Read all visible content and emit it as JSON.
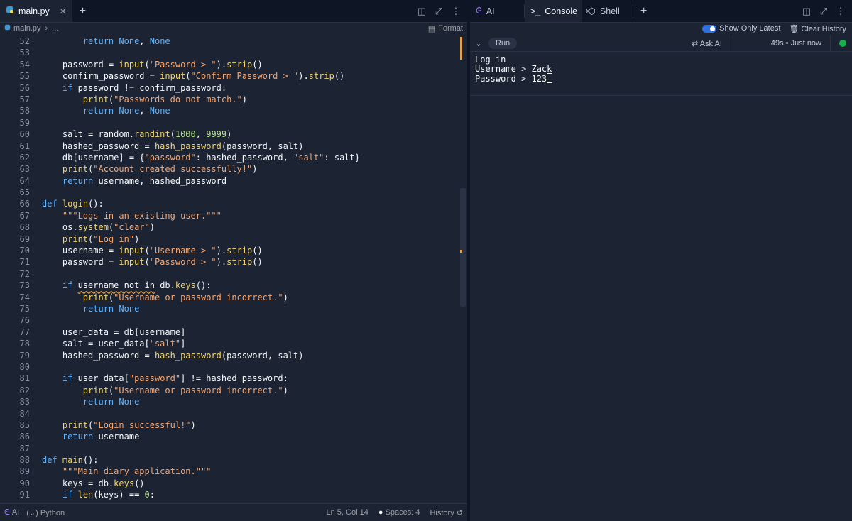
{
  "editor": {
    "tab_label": "main.py",
    "breadcrumb_file": "main.py",
    "breadcrumb_more": "...",
    "format_label": "Format",
    "lines": [
      {
        "n": "52",
        "code": [
          [
            "        ",
            "p"
          ],
          [
            "return",
            "kw"
          ],
          [
            " ",
            "p"
          ],
          [
            "None",
            "const"
          ],
          [
            ", ",
            "p"
          ],
          [
            "None",
            "const"
          ]
        ]
      },
      {
        "n": "53",
        "code": []
      },
      {
        "n": "54",
        "code": [
          [
            "    password = ",
            "p"
          ],
          [
            "input",
            "fn"
          ],
          [
            "(",
            "p"
          ],
          [
            "\"Password > \"",
            "str"
          ],
          [
            ").",
            "p"
          ],
          [
            "strip",
            "fn"
          ],
          [
            "()",
            "p"
          ]
        ]
      },
      {
        "n": "55",
        "code": [
          [
            "    confirm_password = ",
            "p"
          ],
          [
            "input",
            "fn"
          ],
          [
            "(",
            "p"
          ],
          [
            "\"Confirm Password > \"",
            "str"
          ],
          [
            ").",
            "p"
          ],
          [
            "strip",
            "fn"
          ],
          [
            "()",
            "p"
          ]
        ]
      },
      {
        "n": "56",
        "code": [
          [
            "    ",
            "p"
          ],
          [
            "if",
            "kw"
          ],
          [
            " password != confirm_password:",
            "p"
          ]
        ]
      },
      {
        "n": "57",
        "code": [
          [
            "        ",
            "p"
          ],
          [
            "print",
            "fn"
          ],
          [
            "(",
            "p"
          ],
          [
            "\"Passwords do not match.\"",
            "str"
          ],
          [
            ")",
            "p"
          ]
        ]
      },
      {
        "n": "58",
        "code": [
          [
            "        ",
            "p"
          ],
          [
            "return",
            "kw"
          ],
          [
            " ",
            "p"
          ],
          [
            "None",
            "const"
          ],
          [
            ", ",
            "p"
          ],
          [
            "None",
            "const"
          ]
        ]
      },
      {
        "n": "59",
        "code": []
      },
      {
        "n": "60",
        "code": [
          [
            "    salt = random.",
            "p"
          ],
          [
            "randint",
            "fn"
          ],
          [
            "(",
            "p"
          ],
          [
            "1000",
            "num"
          ],
          [
            ", ",
            "p"
          ],
          [
            "9999",
            "num"
          ],
          [
            ")",
            "p"
          ]
        ]
      },
      {
        "n": "61",
        "code": [
          [
            "    hashed_password = ",
            "p"
          ],
          [
            "hash_password",
            "fn"
          ],
          [
            "(password, salt)",
            "p"
          ]
        ]
      },
      {
        "n": "62",
        "code": [
          [
            "    db[username] = {",
            "p"
          ],
          [
            "\"password\"",
            "str"
          ],
          [
            ": hashed_password, ",
            "p"
          ],
          [
            "\"salt\"",
            "str"
          ],
          [
            ": salt}",
            "p"
          ]
        ]
      },
      {
        "n": "63",
        "code": [
          [
            "    ",
            "p"
          ],
          [
            "print",
            "fn"
          ],
          [
            "(",
            "p"
          ],
          [
            "\"Account created successfully!\"",
            "str"
          ],
          [
            ")",
            "p"
          ]
        ]
      },
      {
        "n": "64",
        "code": [
          [
            "    ",
            "p"
          ],
          [
            "return",
            "kw"
          ],
          [
            " username, hashed_password",
            "p"
          ]
        ]
      },
      {
        "n": "65",
        "code": []
      },
      {
        "n": "66",
        "code": [
          [
            "def",
            "kw"
          ],
          [
            " ",
            "p"
          ],
          [
            "login",
            "fn"
          ],
          [
            "():",
            "p"
          ]
        ]
      },
      {
        "n": "67",
        "code": [
          [
            "    ",
            "p"
          ],
          [
            "\"\"\"Logs in an existing user.\"\"\"",
            "doc"
          ]
        ]
      },
      {
        "n": "68",
        "code": [
          [
            "    os.",
            "p"
          ],
          [
            "system",
            "fn"
          ],
          [
            "(",
            "p"
          ],
          [
            "\"clear\"",
            "str"
          ],
          [
            ")",
            "p"
          ]
        ]
      },
      {
        "n": "69",
        "code": [
          [
            "    ",
            "p"
          ],
          [
            "print",
            "fn"
          ],
          [
            "(",
            "p"
          ],
          [
            "\"Log in\"",
            "str"
          ],
          [
            ")",
            "p"
          ]
        ]
      },
      {
        "n": "70",
        "code": [
          [
            "    username = ",
            "p"
          ],
          [
            "input",
            "fn"
          ],
          [
            "(",
            "p"
          ],
          [
            "\"Username > \"",
            "str"
          ],
          [
            ").",
            "p"
          ],
          [
            "strip",
            "fn"
          ],
          [
            "()",
            "p"
          ]
        ]
      },
      {
        "n": "71",
        "code": [
          [
            "    password = ",
            "p"
          ],
          [
            "input",
            "fn"
          ],
          [
            "(",
            "p"
          ],
          [
            "\"Password > \"",
            "str"
          ],
          [
            ").",
            "p"
          ],
          [
            "strip",
            "fn"
          ],
          [
            "()",
            "p"
          ]
        ]
      },
      {
        "n": "72",
        "code": []
      },
      {
        "n": "73",
        "code": [
          [
            "    ",
            "p"
          ],
          [
            "if",
            "kw"
          ],
          [
            " ",
            "p"
          ],
          [
            "username not in",
            "sq"
          ],
          [
            " db.",
            "p"
          ],
          [
            "keys",
            "fn"
          ],
          [
            "():",
            "p"
          ]
        ]
      },
      {
        "n": "74",
        "code": [
          [
            "        ",
            "p"
          ],
          [
            "print",
            "fn"
          ],
          [
            "(",
            "p"
          ],
          [
            "\"Username or password incorrect.\"",
            "str"
          ],
          [
            ")",
            "p"
          ]
        ]
      },
      {
        "n": "75",
        "code": [
          [
            "        ",
            "p"
          ],
          [
            "return",
            "kw"
          ],
          [
            " ",
            "p"
          ],
          [
            "None",
            "const"
          ]
        ]
      },
      {
        "n": "76",
        "code": []
      },
      {
        "n": "77",
        "code": [
          [
            "    user_data = db[username]",
            "p"
          ]
        ]
      },
      {
        "n": "78",
        "code": [
          [
            "    salt = user_data[",
            "p"
          ],
          [
            "\"salt\"",
            "str"
          ],
          [
            "]",
            "p"
          ]
        ]
      },
      {
        "n": "79",
        "code": [
          [
            "    hashed_password = ",
            "p"
          ],
          [
            "hash_password",
            "fn"
          ],
          [
            "(password, salt)",
            "p"
          ]
        ]
      },
      {
        "n": "80",
        "code": []
      },
      {
        "n": "81",
        "code": [
          [
            "    ",
            "p"
          ],
          [
            "if",
            "kw"
          ],
          [
            " user_data[",
            "p"
          ],
          [
            "\"password\"",
            "str"
          ],
          [
            "] != hashed_password:",
            "p"
          ]
        ]
      },
      {
        "n": "82",
        "code": [
          [
            "        ",
            "p"
          ],
          [
            "print",
            "fn"
          ],
          [
            "(",
            "p"
          ],
          [
            "\"Username or password incorrect.\"",
            "str"
          ],
          [
            ")",
            "p"
          ]
        ]
      },
      {
        "n": "83",
        "code": [
          [
            "        ",
            "p"
          ],
          [
            "return",
            "kw"
          ],
          [
            " ",
            "p"
          ],
          [
            "None",
            "const"
          ]
        ]
      },
      {
        "n": "84",
        "code": []
      },
      {
        "n": "85",
        "code": [
          [
            "    ",
            "p"
          ],
          [
            "print",
            "fn"
          ],
          [
            "(",
            "p"
          ],
          [
            "\"Login successful!\"",
            "str"
          ],
          [
            ")",
            "p"
          ]
        ]
      },
      {
        "n": "86",
        "code": [
          [
            "    ",
            "p"
          ],
          [
            "return",
            "kw"
          ],
          [
            " username",
            "p"
          ]
        ]
      },
      {
        "n": "87",
        "code": []
      },
      {
        "n": "88",
        "code": [
          [
            "def",
            "kw"
          ],
          [
            " ",
            "p"
          ],
          [
            "main",
            "fn"
          ],
          [
            "():",
            "p"
          ]
        ]
      },
      {
        "n": "89",
        "code": [
          [
            "    ",
            "p"
          ],
          [
            "\"\"\"Main diary application.\"\"\"",
            "doc"
          ]
        ]
      },
      {
        "n": "90",
        "code": [
          [
            "    keys = db.",
            "p"
          ],
          [
            "keys",
            "fn"
          ],
          [
            "()",
            "p"
          ]
        ]
      },
      {
        "n": "91",
        "code": [
          [
            "    ",
            "p"
          ],
          [
            "if",
            "kw"
          ],
          [
            " ",
            "p"
          ],
          [
            "len",
            "fn"
          ],
          [
            "(keys) == ",
            "p"
          ],
          [
            "0",
            "num"
          ],
          [
            ":",
            "p"
          ]
        ]
      }
    ]
  },
  "status": {
    "ai_label": "AI",
    "language": "Python",
    "cursor_pos": "Ln 5, Col 14",
    "spaces": "Spaces: 4",
    "history": "History"
  },
  "console_tabs": {
    "ai": "AI",
    "console": "Console",
    "shell": "Shell"
  },
  "console": {
    "show_only_latest": "Show Only Latest",
    "clear_history": "Clear History",
    "run_label": "Run",
    "ask_ai": "Ask AI",
    "time": "49s • Just now",
    "output_line1": "Log in",
    "output_line2": "Username > Zack",
    "output_line3": "Password > 123"
  },
  "colors": {
    "background": "#1c2333",
    "keyword": "#5fb4ff",
    "function": "#f2d469",
    "string": "#f5a56e",
    "number": "#b3e08a",
    "status_ok": "#15b34a"
  }
}
